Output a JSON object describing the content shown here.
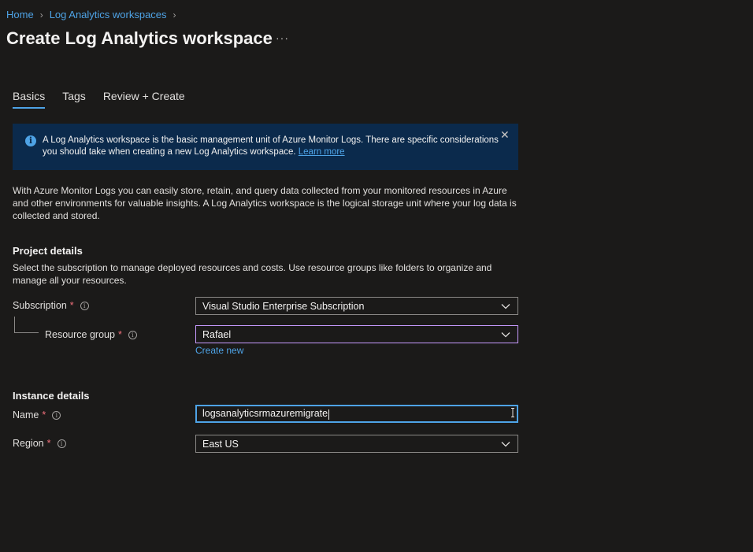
{
  "breadcrumb": {
    "items": [
      "Home",
      "Log Analytics workspaces"
    ]
  },
  "page": {
    "title": "Create Log Analytics workspace",
    "more": "···"
  },
  "tabs": [
    {
      "label": "Basics",
      "active": true
    },
    {
      "label": "Tags",
      "active": false
    },
    {
      "label": "Review + Create",
      "active": false
    }
  ],
  "infobar": {
    "text": "A Log Analytics workspace is the basic management unit of Azure Monitor Logs. There are specific considerations you should take when creating a new Log Analytics workspace.",
    "link": "Learn more",
    "icon": "info-icon",
    "close_icon": "close-icon"
  },
  "description": "With Azure Monitor Logs you can easily store, retain, and query data collected from your monitored resources in Azure and other environments for valuable insights. A Log Analytics workspace is the logical storage unit where your log data is collected and stored.",
  "project": {
    "heading": "Project details",
    "text": "Select the subscription to manage deployed resources and costs. Use resource groups like folders to organize and manage all your resources.",
    "subscription_label": "Subscription",
    "subscription_value": "Visual Studio Enterprise Subscription",
    "resource_group_label": "Resource group",
    "resource_group_value": "Rafael",
    "create_new": "Create new"
  },
  "instance": {
    "heading": "Instance details",
    "name_label": "Name",
    "name_value": "logsanalyticsrmazuremigrate",
    "region_label": "Region",
    "region_value": "East US"
  },
  "required_mark": "*",
  "colors": {
    "accent": "#4ea3e6",
    "infobar_bg": "#0b2a4c",
    "required": "#f1707b",
    "background": "#1b1a19"
  }
}
